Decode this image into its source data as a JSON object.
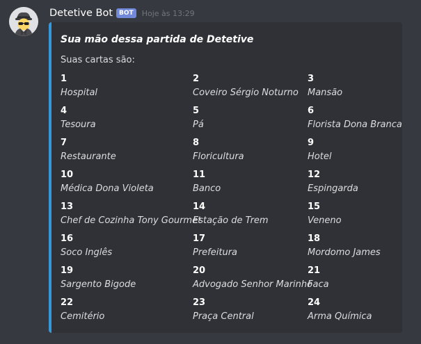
{
  "message": {
    "username": "Detetive Bot",
    "bot_tag": "BOT",
    "timestamp": "Hoje às 13:29"
  },
  "embed": {
    "accent_color": "#3498db",
    "title": "Sua mão dessa partida de Detetive",
    "description": "Suas cartas são:",
    "fields": [
      {
        "name": "1",
        "value": "Hospital"
      },
      {
        "name": "2",
        "value": "Coveiro Sérgio Noturno"
      },
      {
        "name": "3",
        "value": "Mansão"
      },
      {
        "name": "4",
        "value": "Tesoura"
      },
      {
        "name": "5",
        "value": "Pá"
      },
      {
        "name": "6",
        "value": "Florista Dona Branca"
      },
      {
        "name": "7",
        "value": "Restaurante"
      },
      {
        "name": "8",
        "value": "Floricultura"
      },
      {
        "name": "9",
        "value": "Hotel"
      },
      {
        "name": "10",
        "value": "Médica Dona Violeta"
      },
      {
        "name": "11",
        "value": "Banco"
      },
      {
        "name": "12",
        "value": "Espingarda"
      },
      {
        "name": "13",
        "value": "Chef de Cozinha Tony Gourmet"
      },
      {
        "name": "14",
        "value": "Estação de Trem"
      },
      {
        "name": "15",
        "value": "Veneno"
      },
      {
        "name": "16",
        "value": "Soco Inglês"
      },
      {
        "name": "17",
        "value": "Prefeitura"
      },
      {
        "name": "18",
        "value": "Mordomo James"
      },
      {
        "name": "19",
        "value": "Sargento Bigode"
      },
      {
        "name": "20",
        "value": "Advogado Senhor Marinho"
      },
      {
        "name": "21",
        "value": "Faca"
      },
      {
        "name": "22",
        "value": "Cemitério"
      },
      {
        "name": "23",
        "value": "Praça Central"
      },
      {
        "name": "24",
        "value": "Arma Química"
      }
    ]
  }
}
